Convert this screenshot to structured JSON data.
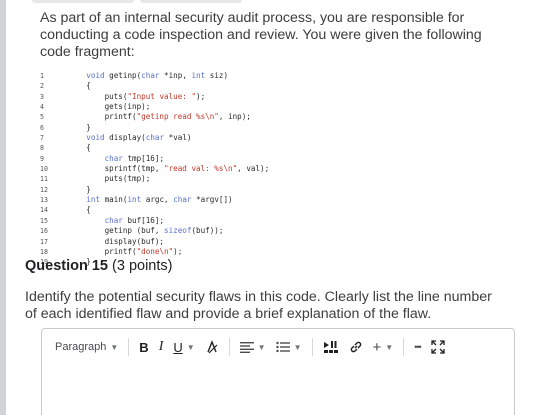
{
  "question": {
    "intro": "As part of an internal security audit process, you are responsible for conducting a code inspection and review. You were given the following code fragment:",
    "title_label": "Question 15",
    "points": "(3 points)",
    "prompt": "Identify the potential security flaws in this code. Clearly list the line number of each identified flaw and provide a brief explanation of the flaw."
  },
  "code_lines": [
    {
      "n": "1",
      "parts": [
        [
          "    ",
          ""
        ],
        [
          "void",
          "kw"
        ],
        [
          " getinp(",
          ""
        ],
        [
          "char",
          "kw"
        ],
        [
          " *inp, ",
          ""
        ],
        [
          "int",
          "kw"
        ],
        [
          " siz)",
          ""
        ]
      ]
    },
    {
      "n": "2",
      "parts": [
        [
          "    {",
          ""
        ]
      ]
    },
    {
      "n": "3",
      "parts": [
        [
          "        puts(",
          ""
        ],
        [
          "\"Input value: \"",
          "str"
        ],
        [
          ");",
          ""
        ]
      ]
    },
    {
      "n": "4",
      "parts": [
        [
          "        gets(inp);",
          ""
        ]
      ]
    },
    {
      "n": "5",
      "parts": [
        [
          "        printf(",
          ""
        ],
        [
          "\"getinp read %s\\n\"",
          "str"
        ],
        [
          ", inp);",
          ""
        ]
      ]
    },
    {
      "n": "6",
      "parts": [
        [
          "    }",
          ""
        ]
      ]
    },
    {
      "n": "7",
      "parts": [
        [
          "    ",
          ""
        ],
        [
          "void",
          "kw"
        ],
        [
          " display(",
          ""
        ],
        [
          "char",
          "kw"
        ],
        [
          " *val)",
          ""
        ]
      ]
    },
    {
      "n": "8",
      "parts": [
        [
          "    {",
          ""
        ]
      ]
    },
    {
      "n": "9",
      "parts": [
        [
          "        ",
          ""
        ],
        [
          "char",
          "kw"
        ],
        [
          " tmp[16];",
          ""
        ]
      ]
    },
    {
      "n": "10",
      "parts": [
        [
          "        sprintf(tmp, ",
          ""
        ],
        [
          "\"read val: %s\\n\"",
          "str"
        ],
        [
          ", val);",
          ""
        ]
      ]
    },
    {
      "n": "11",
      "parts": [
        [
          "        puts(tmp);",
          ""
        ]
      ]
    },
    {
      "n": "12",
      "parts": [
        [
          "    }",
          ""
        ]
      ]
    },
    {
      "n": "13",
      "parts": [
        [
          "    ",
          ""
        ],
        [
          "int",
          "kw"
        ],
        [
          " main(",
          ""
        ],
        [
          "int",
          "kw"
        ],
        [
          " argc, ",
          ""
        ],
        [
          "char",
          "kw"
        ],
        [
          " *argv[])",
          ""
        ]
      ]
    },
    {
      "n": "14",
      "parts": [
        [
          "    {",
          ""
        ]
      ]
    },
    {
      "n": "15",
      "parts": [
        [
          "        ",
          ""
        ],
        [
          "char",
          "kw"
        ],
        [
          " buf[16];",
          ""
        ]
      ]
    },
    {
      "n": "16",
      "parts": [
        [
          "        getinp (buf, ",
          ""
        ],
        [
          "sizeof",
          "kw"
        ],
        [
          "(buf));",
          ""
        ]
      ]
    },
    {
      "n": "17",
      "parts": [
        [
          "        display(buf);",
          ""
        ]
      ]
    },
    {
      "n": "18",
      "parts": [
        [
          "        printf(",
          ""
        ],
        [
          "\"done\\n\"",
          "str"
        ],
        [
          ");",
          ""
        ]
      ]
    },
    {
      "n": "19",
      "parts": [
        [
          "    }",
          ""
        ]
      ]
    }
  ],
  "toolbar": {
    "paragraph_label": "Paragraph",
    "bold": "B",
    "italic": "I",
    "underline": "U",
    "insert_label": "+",
    "more": "•••"
  },
  "colors": {
    "keyword": "#5a6fd0",
    "string": "#c0392b"
  }
}
